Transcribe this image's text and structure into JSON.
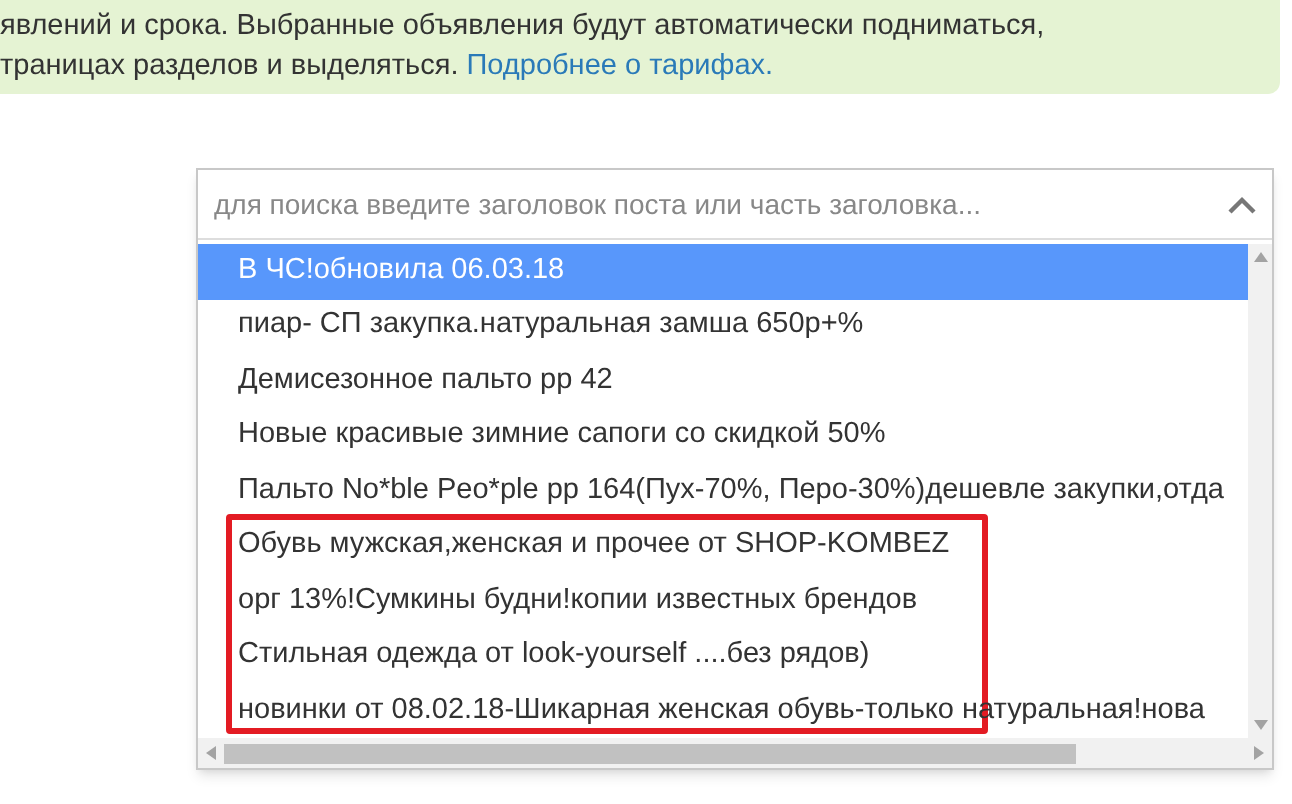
{
  "notice": {
    "lines": [
      "явлений и срока. Выбранные объявления будут автоматически подниматься,",
      "траницах разделов и выделяться."
    ],
    "link": "Подробнее о тарифах."
  },
  "search": {
    "placeholder": "для поиска введите заголовок поста или часть заголовка...",
    "expanded": true
  },
  "options": [
    {
      "label": "В ЧС!обновила 06.03.18",
      "selected": true
    },
    {
      "label": "пиар- СП закупка.натуральная замша 650р+%",
      "selected": false
    },
    {
      "label": "Демисезонное пальто рр 42",
      "selected": false
    },
    {
      "label": "Новые красивые зимние сапоги со скидкой 50%",
      "selected": false
    },
    {
      "label": "Пальто No*ble Peo*ple рр 164(Пух-70%, Перо-30%)дешевле закупки,отда",
      "selected": false
    },
    {
      "label": "Обувь мужская,женская и прочее от SHOP-KOMBEZ",
      "selected": false
    },
    {
      "label": "орг 13%!Сумкины будни!копии известных брендов",
      "selected": false
    },
    {
      "label": "Стильная одежда от look-yourself ....без рядов)",
      "selected": false
    },
    {
      "label": "новинки от 08.02.18-Шикарная женская обувь-только натуральная!нова",
      "selected": false
    }
  ]
}
